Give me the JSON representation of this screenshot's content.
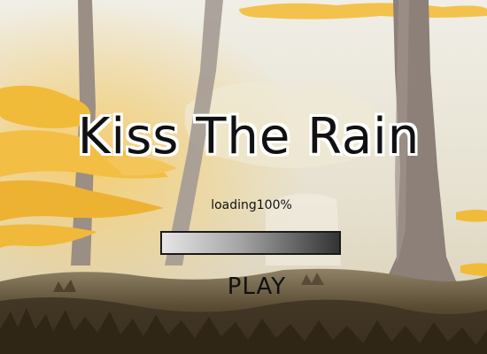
{
  "game": {
    "title": "Kiss The Rain",
    "loading_text": "loading100%",
    "progress": 1.0,
    "play_label": "PLAY"
  },
  "colors": {
    "sky": "#eae8dc",
    "foliage": "#f1bb3a",
    "trunk": "#8b7d74",
    "ground_dark": "#3d3222",
    "ground_light": "#bcae91"
  }
}
